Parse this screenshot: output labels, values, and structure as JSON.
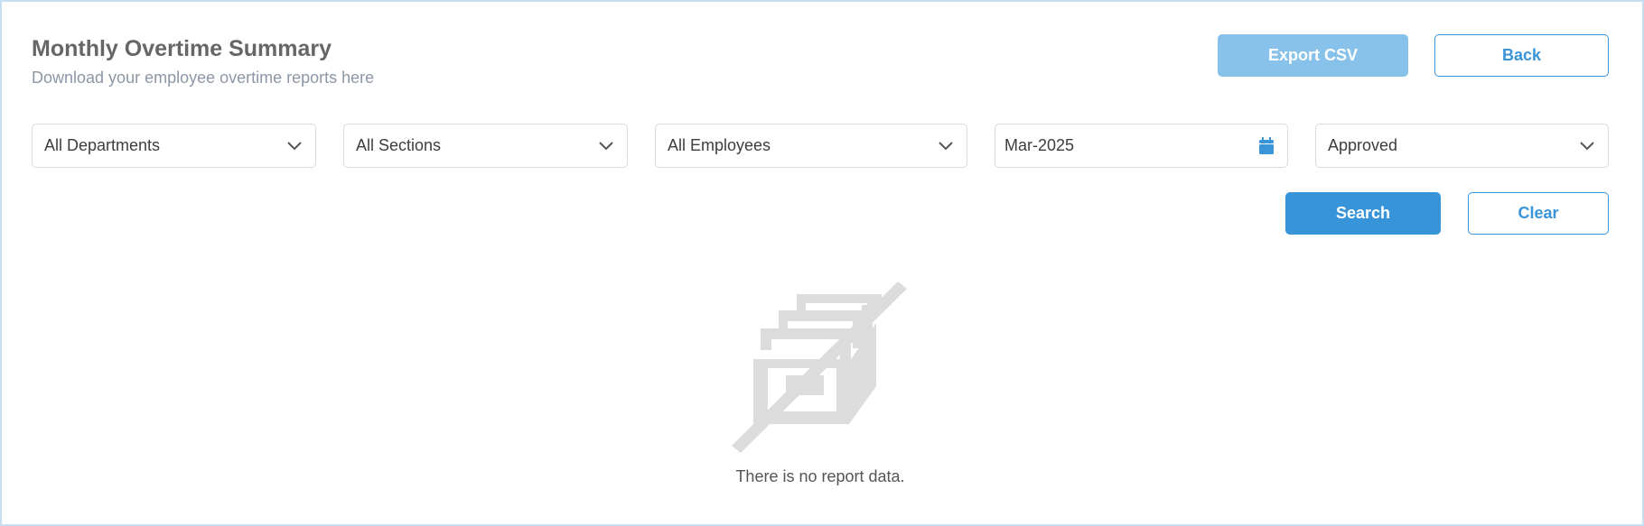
{
  "header": {
    "title": "Monthly Overtime Summary",
    "subtitle": "Download your employee overtime reports here",
    "export_label": "Export CSV",
    "back_label": "Back"
  },
  "filters": {
    "department": "All Departments",
    "section": "All Sections",
    "employee": "All Employees",
    "month": "Mar-2025",
    "status": "Approved"
  },
  "actions": {
    "search_label": "Search",
    "clear_label": "Clear"
  },
  "empty_state": {
    "message": "There is no report data.",
    "icon": "empty-box-icon"
  },
  "colors": {
    "primary": "#3894d9",
    "primary_disabled": "#88c1ea",
    "border": "#c6e0f2",
    "icon_gray": "#dcdcdc"
  }
}
